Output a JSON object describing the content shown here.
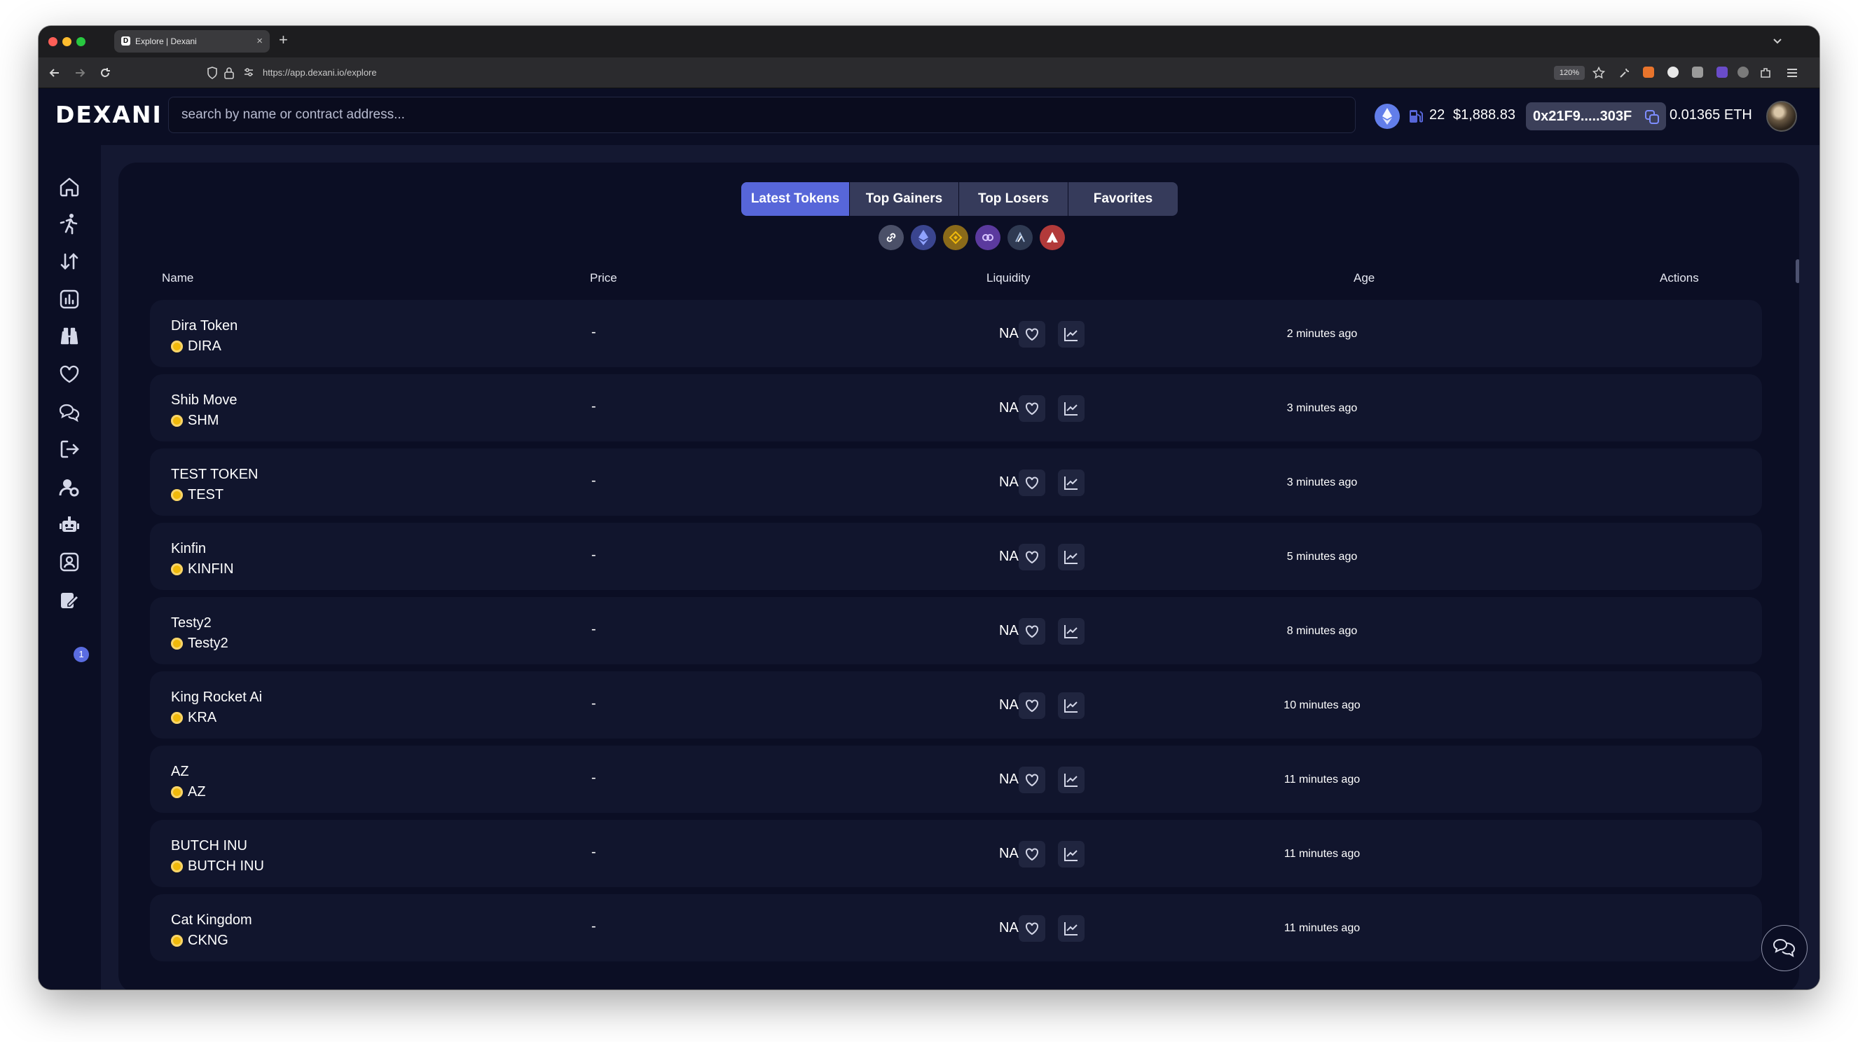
{
  "browser": {
    "tab_title": "Explore | Dexani",
    "tab_favicon": "D",
    "url": "https://app.dexani.io/explore",
    "zoom": "120%"
  },
  "header": {
    "logo": "DEXANI",
    "search_placeholder": "search by name or contract address...",
    "gas": "22",
    "eth_price": "$1,888.83",
    "wallet_address": "0x21F9.....303F",
    "eth_balance": "0.01365 ETH"
  },
  "sidebar": {
    "icons": [
      "home-icon",
      "runner-icon",
      "swap-icon",
      "chart-icon",
      "binoculars-icon",
      "heart-icon",
      "chat-icon",
      "logout-icon",
      "settings-user-icon",
      "robot-icon",
      "contact-icon",
      "notes-icon"
    ],
    "notification_count": "1"
  },
  "explore": {
    "tabs": [
      "Latest Tokens",
      "Top Gainers",
      "Top Losers",
      "Favorites"
    ],
    "active_tab": "Latest Tokens",
    "chains": [
      "link-icon",
      "ethereum-icon",
      "bnb-icon",
      "polygon-icon",
      "arbitrum-icon",
      "avalanche-icon"
    ],
    "columns": [
      "Name",
      "Price",
      "Liquidity",
      "Age",
      "Actions"
    ],
    "rows": [
      {
        "name": "Dira Token",
        "symbol": "DIRA",
        "price": "-",
        "liquidity": "NA",
        "age": "2 minutes ago"
      },
      {
        "name": "Shib Move",
        "symbol": "SHM",
        "price": "-",
        "liquidity": "NA",
        "age": "3 minutes ago"
      },
      {
        "name": "TEST TOKEN",
        "symbol": "TEST",
        "price": "-",
        "liquidity": "NA",
        "age": "3 minutes ago"
      },
      {
        "name": "Kinfin",
        "symbol": "KINFIN",
        "price": "-",
        "liquidity": "NA",
        "age": "5 minutes ago"
      },
      {
        "name": "Testy2",
        "symbol": "Testy2",
        "price": "-",
        "liquidity": "NA",
        "age": "8 minutes ago"
      },
      {
        "name": "King Rocket Ai",
        "symbol": "KRA",
        "price": "-",
        "liquidity": "NA",
        "age": "10 minutes ago"
      },
      {
        "name": "AZ",
        "symbol": "AZ",
        "price": "-",
        "liquidity": "NA",
        "age": "11 minutes ago"
      },
      {
        "name": "BUTCH INU",
        "symbol": "BUTCH INU",
        "price": "-",
        "liquidity": "NA",
        "age": "11 minutes ago"
      },
      {
        "name": "Cat Kingdom",
        "symbol": "CKNG",
        "price": "-",
        "liquidity": "NA",
        "age": "11 minutes ago"
      }
    ]
  },
  "colors": {
    "accent": "#5766d9",
    "background": "#0b0e24",
    "row": "#11152d",
    "eth": "#627eea",
    "coin": "#f0b90b"
  }
}
